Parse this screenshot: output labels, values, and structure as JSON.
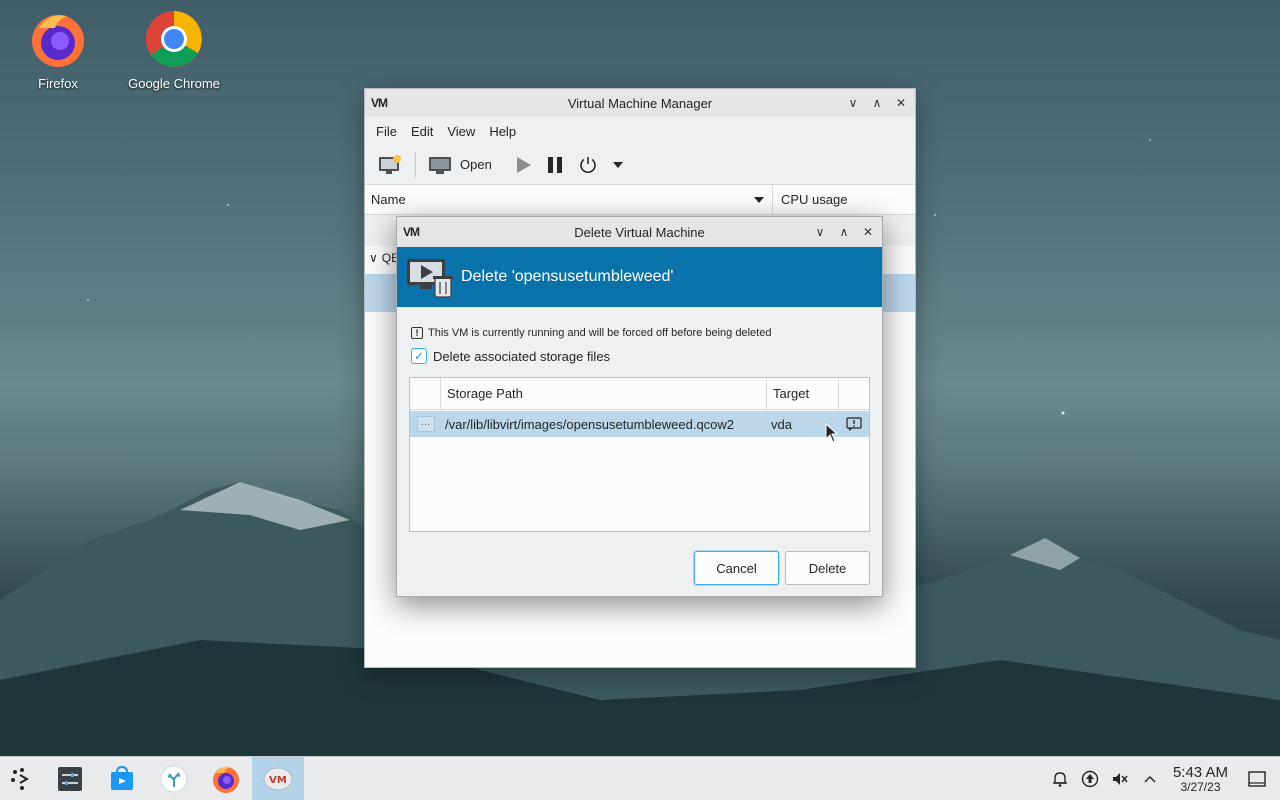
{
  "desktop": {
    "icons": [
      {
        "label": "Firefox"
      },
      {
        "label": "Google Chrome"
      }
    ]
  },
  "vmm": {
    "title": "Virtual Machine Manager",
    "menu": [
      "File",
      "Edit",
      "View",
      "Help"
    ],
    "toolbar": {
      "open_label": "Open"
    },
    "list_columns": {
      "name": "Name",
      "cpu": "CPU usage"
    },
    "group_label": "QE"
  },
  "dialog": {
    "title": "Delete Virtual Machine",
    "banner": "Delete 'opensusetumbleweed'",
    "warning": "This VM is currently running and will be forced off before being deleted",
    "checkbox_label": "Delete associated storage files",
    "checkbox_checked": true,
    "storage_columns": {
      "path": "Storage Path",
      "target": "Target"
    },
    "storage_rows": [
      {
        "path": "/var/lib/libvirt/images/opensusetumbleweed.qcow2",
        "target": "vda"
      }
    ],
    "cancel_label": "Cancel",
    "delete_label": "Delete"
  },
  "taskbar": {
    "time": "5:43 AM",
    "date": "3/27/23"
  },
  "colors": {
    "accent": "#0a72ab",
    "selection": "#bcd6ea"
  }
}
